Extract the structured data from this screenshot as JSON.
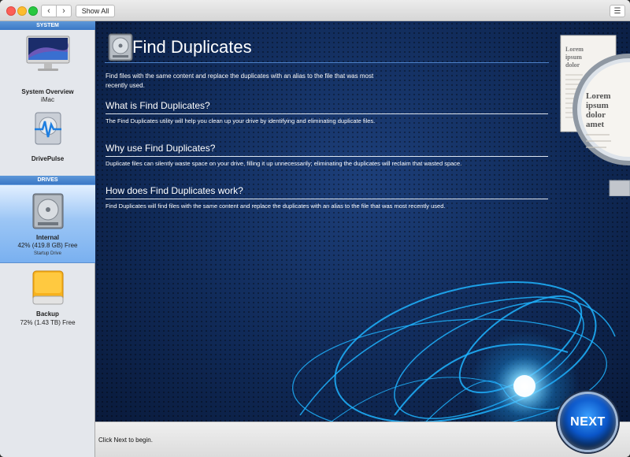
{
  "toolbar": {
    "back_icon": "‹",
    "forward_icon": "›",
    "show_all_label": "Show All",
    "list_icon": "☰"
  },
  "sidebar": {
    "system_header": "SYSTEM",
    "drives_header": "DRIVES",
    "system_items": [
      {
        "label": "System Overview",
        "sub": "iMac"
      },
      {
        "label": "DrivePulse"
      }
    ],
    "drive_items": [
      {
        "label": "Internal",
        "sub": "42% (419.8 GB) Free",
        "tiny": "Startup Drive",
        "selected": true
      },
      {
        "label": "Backup",
        "sub": "72% (1.43 TB) Free"
      }
    ]
  },
  "main": {
    "title": "Find Duplicates",
    "intro": "Find files with the same content and replace the duplicates with an alias to the file that was most recently used.",
    "sections": [
      {
        "heading": "What is Find Duplicates?",
        "text": "The Find Duplicates utility will help you clean up your drive by identifying and eliminating duplicate files."
      },
      {
        "heading": "Why use Find Duplicates?",
        "text": "Duplicate files can silently waste space on your drive, filling it up unnecessarily; eliminating the duplicates will reclaim that wasted space."
      },
      {
        "heading": "How does Find Duplicates work?",
        "text": "Find Duplicates will find files with the same content and replace the duplicates with an alias to the file that was most recently used."
      }
    ],
    "art_text": {
      "back_page": [
        "Lorem",
        "ipsum",
        "dolor"
      ],
      "lens_page": [
        "Lorem",
        "ipsum",
        "dolor",
        "amet"
      ]
    }
  },
  "footer": {
    "message": "Click Next to begin.",
    "next_label": "NEXT"
  },
  "colors": {
    "accent": "#3b78c6",
    "background_main": "#102a58",
    "glow": "#1eb4ff"
  }
}
